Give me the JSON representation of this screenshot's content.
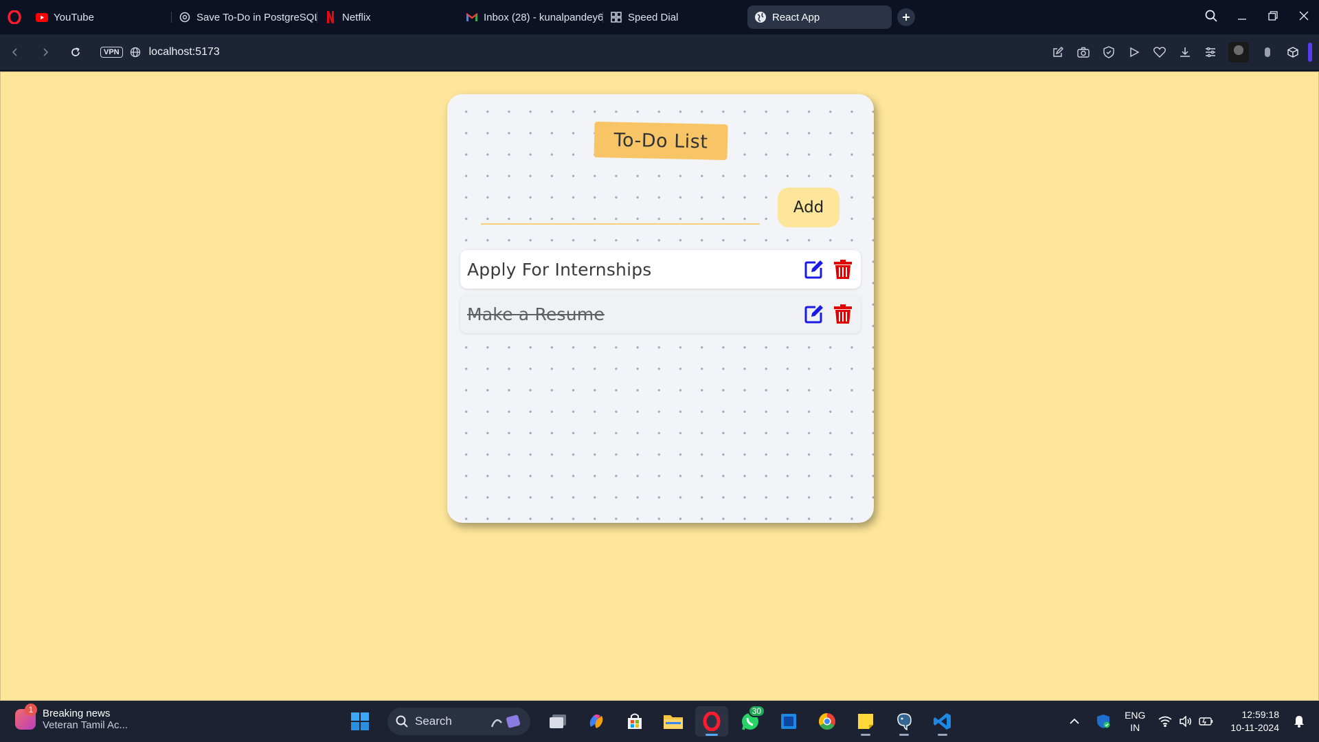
{
  "browser": {
    "tabs": [
      {
        "label": "YouTube",
        "icon": "youtube-icon"
      },
      {
        "label": "Save To-Do in PostgreSQL",
        "icon": "chatgpt-icon"
      },
      {
        "label": "Netflix",
        "icon": "netflix-icon"
      },
      {
        "label": "Inbox (28) - kunalpandey6",
        "icon": "gmail-icon"
      },
      {
        "label": "Speed Dial",
        "icon": "speed-dial-icon"
      },
      {
        "label": "React App",
        "icon": "globe-icon",
        "active": true
      }
    ],
    "url": "localhost:5173",
    "vpn_label": "VPN"
  },
  "app": {
    "title": "To-Do List",
    "input": {
      "value": "",
      "placeholder": ""
    },
    "add_label": "Add",
    "todos": [
      {
        "text": "Apply For Internships",
        "completed": false
      },
      {
        "text": "Make a Resume",
        "completed": true
      }
    ],
    "colors": {
      "page_bg": "#fde69a",
      "title_bg": "#f7c566",
      "edit_icon": "#1a1ae6",
      "delete_icon": "#e00000"
    }
  },
  "taskbar": {
    "news": {
      "badge": "1",
      "title": "Breaking news",
      "subtitle": "Veteran Tamil Ac..."
    },
    "search_label": "Search",
    "whatsapp_badge": "30",
    "lang": {
      "line1": "ENG",
      "line2": "IN"
    },
    "clock": {
      "time": "12:59:18",
      "date": "10-11-2024"
    }
  }
}
